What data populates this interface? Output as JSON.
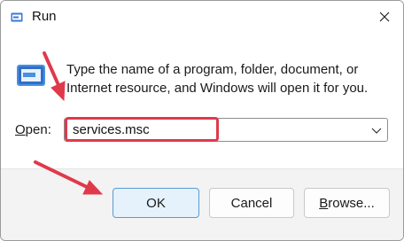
{
  "window": {
    "title": "Run",
    "close_icon": "close-icon"
  },
  "dialog": {
    "description": "Type the name of a program, folder, document, or Internet resource, and Windows will open it for you.",
    "open_label_accel": "O",
    "open_label_rest": "pen:",
    "open_value": "services.msc"
  },
  "buttons": {
    "ok": "OK",
    "cancel": "Cancel",
    "browse_accel": "B",
    "browse_rest": "rowse..."
  },
  "annotation": {
    "color": "#e0394b"
  }
}
